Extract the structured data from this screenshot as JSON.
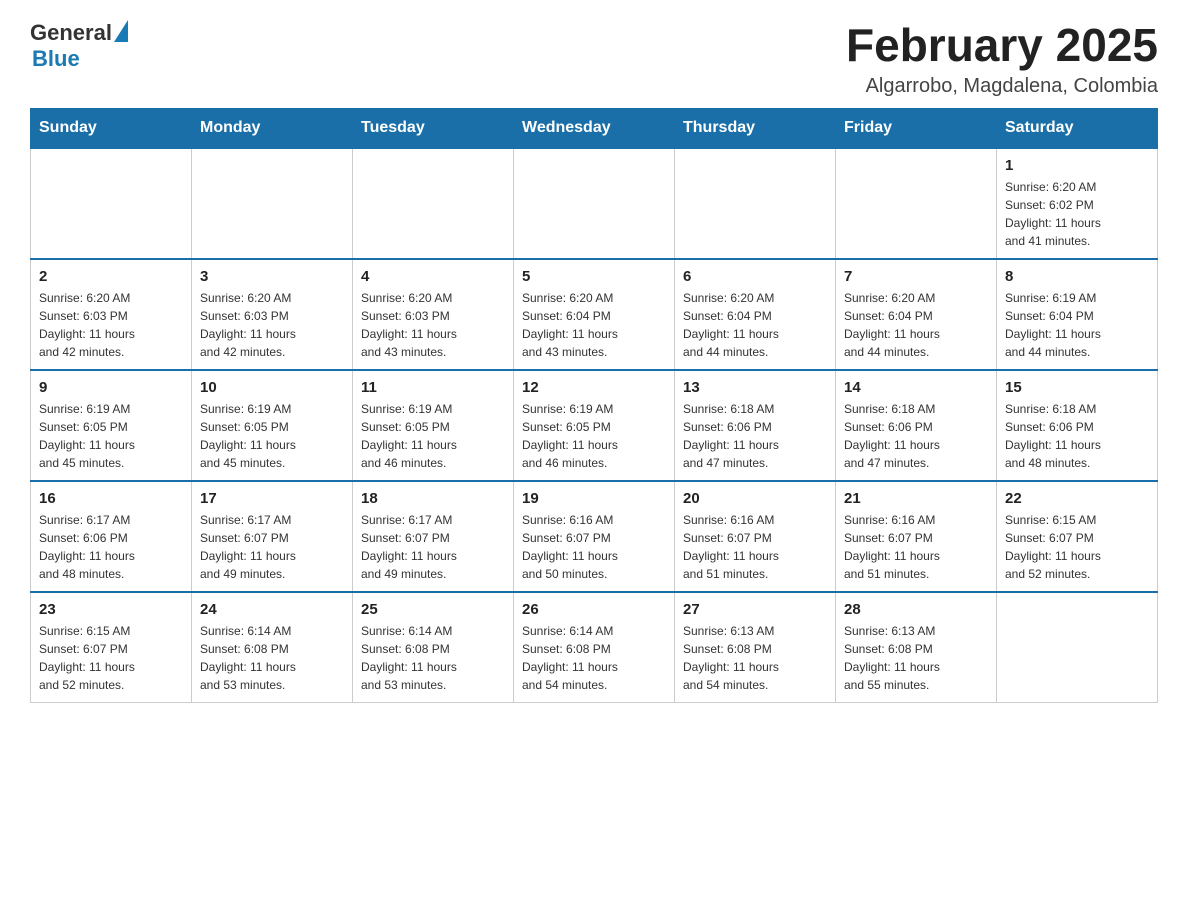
{
  "header": {
    "logo": {
      "general": "General",
      "blue": "Blue",
      "alt": "GeneralBlue logo"
    },
    "title": "February 2025",
    "location": "Algarrobo, Magdalena, Colombia"
  },
  "weekdays": [
    "Sunday",
    "Monday",
    "Tuesday",
    "Wednesday",
    "Thursday",
    "Friday",
    "Saturday"
  ],
  "weeks": [
    [
      {
        "day": "",
        "info": ""
      },
      {
        "day": "",
        "info": ""
      },
      {
        "day": "",
        "info": ""
      },
      {
        "day": "",
        "info": ""
      },
      {
        "day": "",
        "info": ""
      },
      {
        "day": "",
        "info": ""
      },
      {
        "day": "1",
        "info": "Sunrise: 6:20 AM\nSunset: 6:02 PM\nDaylight: 11 hours\nand 41 minutes."
      }
    ],
    [
      {
        "day": "2",
        "info": "Sunrise: 6:20 AM\nSunset: 6:03 PM\nDaylight: 11 hours\nand 42 minutes."
      },
      {
        "day": "3",
        "info": "Sunrise: 6:20 AM\nSunset: 6:03 PM\nDaylight: 11 hours\nand 42 minutes."
      },
      {
        "day": "4",
        "info": "Sunrise: 6:20 AM\nSunset: 6:03 PM\nDaylight: 11 hours\nand 43 minutes."
      },
      {
        "day": "5",
        "info": "Sunrise: 6:20 AM\nSunset: 6:04 PM\nDaylight: 11 hours\nand 43 minutes."
      },
      {
        "day": "6",
        "info": "Sunrise: 6:20 AM\nSunset: 6:04 PM\nDaylight: 11 hours\nand 44 minutes."
      },
      {
        "day": "7",
        "info": "Sunrise: 6:20 AM\nSunset: 6:04 PM\nDaylight: 11 hours\nand 44 minutes."
      },
      {
        "day": "8",
        "info": "Sunrise: 6:19 AM\nSunset: 6:04 PM\nDaylight: 11 hours\nand 44 minutes."
      }
    ],
    [
      {
        "day": "9",
        "info": "Sunrise: 6:19 AM\nSunset: 6:05 PM\nDaylight: 11 hours\nand 45 minutes."
      },
      {
        "day": "10",
        "info": "Sunrise: 6:19 AM\nSunset: 6:05 PM\nDaylight: 11 hours\nand 45 minutes."
      },
      {
        "day": "11",
        "info": "Sunrise: 6:19 AM\nSunset: 6:05 PM\nDaylight: 11 hours\nand 46 minutes."
      },
      {
        "day": "12",
        "info": "Sunrise: 6:19 AM\nSunset: 6:05 PM\nDaylight: 11 hours\nand 46 minutes."
      },
      {
        "day": "13",
        "info": "Sunrise: 6:18 AM\nSunset: 6:06 PM\nDaylight: 11 hours\nand 47 minutes."
      },
      {
        "day": "14",
        "info": "Sunrise: 6:18 AM\nSunset: 6:06 PM\nDaylight: 11 hours\nand 47 minutes."
      },
      {
        "day": "15",
        "info": "Sunrise: 6:18 AM\nSunset: 6:06 PM\nDaylight: 11 hours\nand 48 minutes."
      }
    ],
    [
      {
        "day": "16",
        "info": "Sunrise: 6:17 AM\nSunset: 6:06 PM\nDaylight: 11 hours\nand 48 minutes."
      },
      {
        "day": "17",
        "info": "Sunrise: 6:17 AM\nSunset: 6:07 PM\nDaylight: 11 hours\nand 49 minutes."
      },
      {
        "day": "18",
        "info": "Sunrise: 6:17 AM\nSunset: 6:07 PM\nDaylight: 11 hours\nand 49 minutes."
      },
      {
        "day": "19",
        "info": "Sunrise: 6:16 AM\nSunset: 6:07 PM\nDaylight: 11 hours\nand 50 minutes."
      },
      {
        "day": "20",
        "info": "Sunrise: 6:16 AM\nSunset: 6:07 PM\nDaylight: 11 hours\nand 51 minutes."
      },
      {
        "day": "21",
        "info": "Sunrise: 6:16 AM\nSunset: 6:07 PM\nDaylight: 11 hours\nand 51 minutes."
      },
      {
        "day": "22",
        "info": "Sunrise: 6:15 AM\nSunset: 6:07 PM\nDaylight: 11 hours\nand 52 minutes."
      }
    ],
    [
      {
        "day": "23",
        "info": "Sunrise: 6:15 AM\nSunset: 6:07 PM\nDaylight: 11 hours\nand 52 minutes."
      },
      {
        "day": "24",
        "info": "Sunrise: 6:14 AM\nSunset: 6:08 PM\nDaylight: 11 hours\nand 53 minutes."
      },
      {
        "day": "25",
        "info": "Sunrise: 6:14 AM\nSunset: 6:08 PM\nDaylight: 11 hours\nand 53 minutes."
      },
      {
        "day": "26",
        "info": "Sunrise: 6:14 AM\nSunset: 6:08 PM\nDaylight: 11 hours\nand 54 minutes."
      },
      {
        "day": "27",
        "info": "Sunrise: 6:13 AM\nSunset: 6:08 PM\nDaylight: 11 hours\nand 54 minutes."
      },
      {
        "day": "28",
        "info": "Sunrise: 6:13 AM\nSunset: 6:08 PM\nDaylight: 11 hours\nand 55 minutes."
      },
      {
        "day": "",
        "info": ""
      }
    ]
  ]
}
